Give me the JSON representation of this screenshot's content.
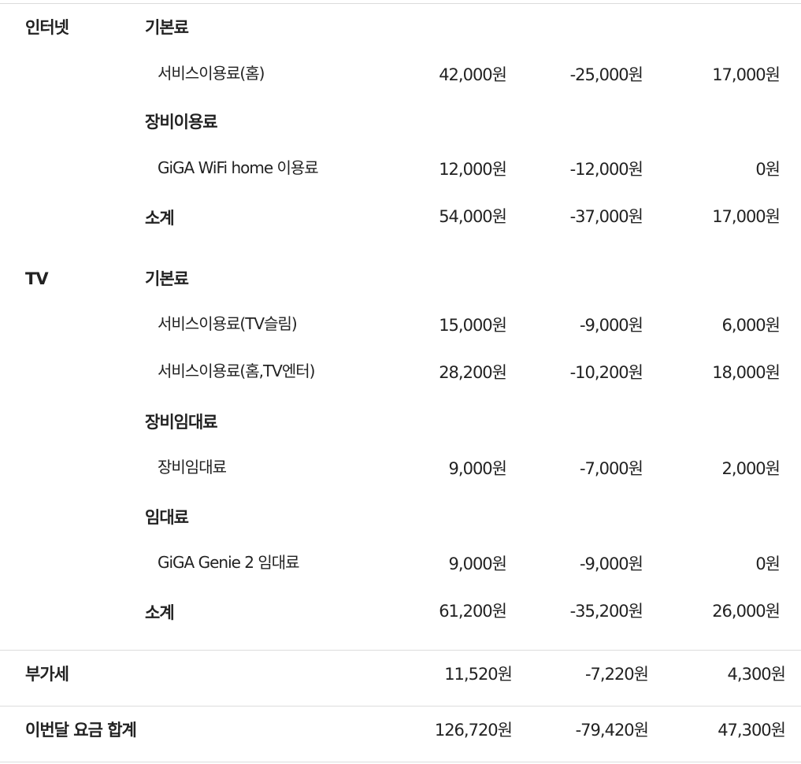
{
  "internet": {
    "label": "인터넷",
    "basic_fee": {
      "label": "기본료",
      "items": [
        {
          "name": "서비스이용료(홈)",
          "charge": "42,000원",
          "discount": "-25,000원",
          "total": "17,000원"
        }
      ]
    },
    "equipment_fee": {
      "label": "장비이용료",
      "items": [
        {
          "name": "GiGA WiFi home 이용료",
          "charge": "12,000원",
          "discount": "-12,000원",
          "total": "0원"
        }
      ]
    },
    "subtotal": {
      "label": "소계",
      "charge": "54,000원",
      "discount": "-37,000원",
      "total": "17,000원"
    }
  },
  "tv": {
    "label": "TV",
    "basic_fee": {
      "label": "기본료",
      "items": [
        {
          "name": "서비스이용료(TV슬림)",
          "charge": "15,000원",
          "discount": "-9,000원",
          "total": "6,000원"
        },
        {
          "name": "서비스이용료(홈,TV엔터)",
          "charge": "28,200원",
          "discount": "-10,200원",
          "total": "18,000원"
        }
      ]
    },
    "equipment_rental": {
      "label": "장비임대료",
      "items": [
        {
          "name": "장비임대료",
          "charge": "9,000원",
          "discount": "-7,000원",
          "total": "2,000원"
        }
      ]
    },
    "rental": {
      "label": "임대료",
      "items": [
        {
          "name": "GiGA Genie 2 임대료",
          "charge": "9,000원",
          "discount": "-9,000원",
          "total": "0원"
        }
      ]
    },
    "subtotal": {
      "label": "소계",
      "charge": "61,200원",
      "discount": "-35,200원",
      "total": "26,000원"
    }
  },
  "vat": {
    "label": "부가세",
    "charge": "11,520원",
    "discount": "-7,220원",
    "total": "4,300원"
  },
  "grand_total": {
    "label": "이번달 요금 합계",
    "charge": "126,720원",
    "discount": "-79,420원",
    "total": "47,300원"
  }
}
